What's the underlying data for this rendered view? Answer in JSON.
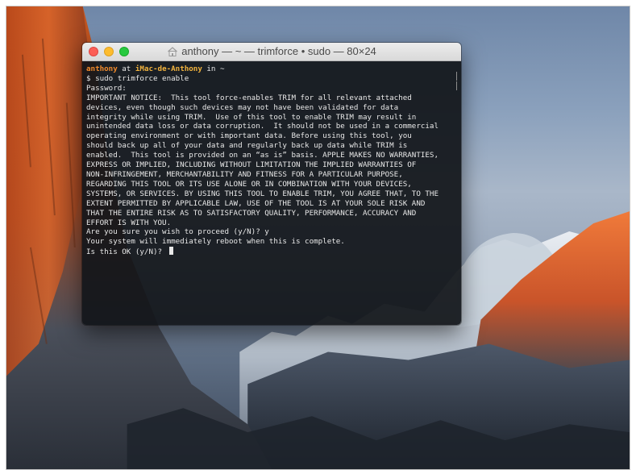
{
  "window": {
    "title": "anthony — ~ — trimforce • sudo — 80×24"
  },
  "prompt": {
    "user": "anthony",
    "at": " at ",
    "host": "iMac-de-Anthony",
    "in": " in ",
    "dir": "~"
  },
  "terminal_lines": [
    "$ sudo trimforce enable",
    "Password:",
    "IMPORTANT NOTICE:  This tool force-enables TRIM for all relevant attached",
    "devices, even though such devices may not have been validated for data",
    "integrity while using TRIM.  Use of this tool to enable TRIM may result in",
    "unintended data loss or data corruption.  It should not be used in a commercial",
    "operating environment or with important data. Before using this tool, you",
    "should back up all of your data and regularly back up data while TRIM is",
    "enabled.  This tool is provided on an “as is” basis. APPLE MAKES NO WARRANTIES,",
    "EXPRESS OR IMPLIED, INCLUDING WITHOUT LIMITATION THE IMPLIED WARRANTIES OF",
    "NON-INFRINGEMENT, MERCHANTABILITY AND FITNESS FOR A PARTICULAR PURPOSE,",
    "REGARDING THIS TOOL OR ITS USE ALONE OR IN COMBINATION WITH YOUR DEVICES,",
    "SYSTEMS, OR SERVICES. BY USING THIS TOOL TO ENABLE TRIM, YOU AGREE THAT, TO THE",
    "EXTENT PERMITTED BY APPLICABLE LAW, USE OF THE TOOL IS AT YOUR SOLE RISK AND",
    "THAT THE ENTIRE RISK AS TO SATISFACTORY QUALITY, PERFORMANCE, ACCURACY AND",
    "EFFORT IS WITH YOU.",
    "Are you sure you wish to proceed (y/N)? y",
    "Your system will immediately reboot when this is complete.",
    "Is this OK (y/N)? "
  ],
  "colors": {
    "prompt_user": "#f28b2c",
    "prompt_host": "#f2b33d",
    "terminal_text": "#e8e8e8",
    "terminal_bg": "#12161a"
  }
}
